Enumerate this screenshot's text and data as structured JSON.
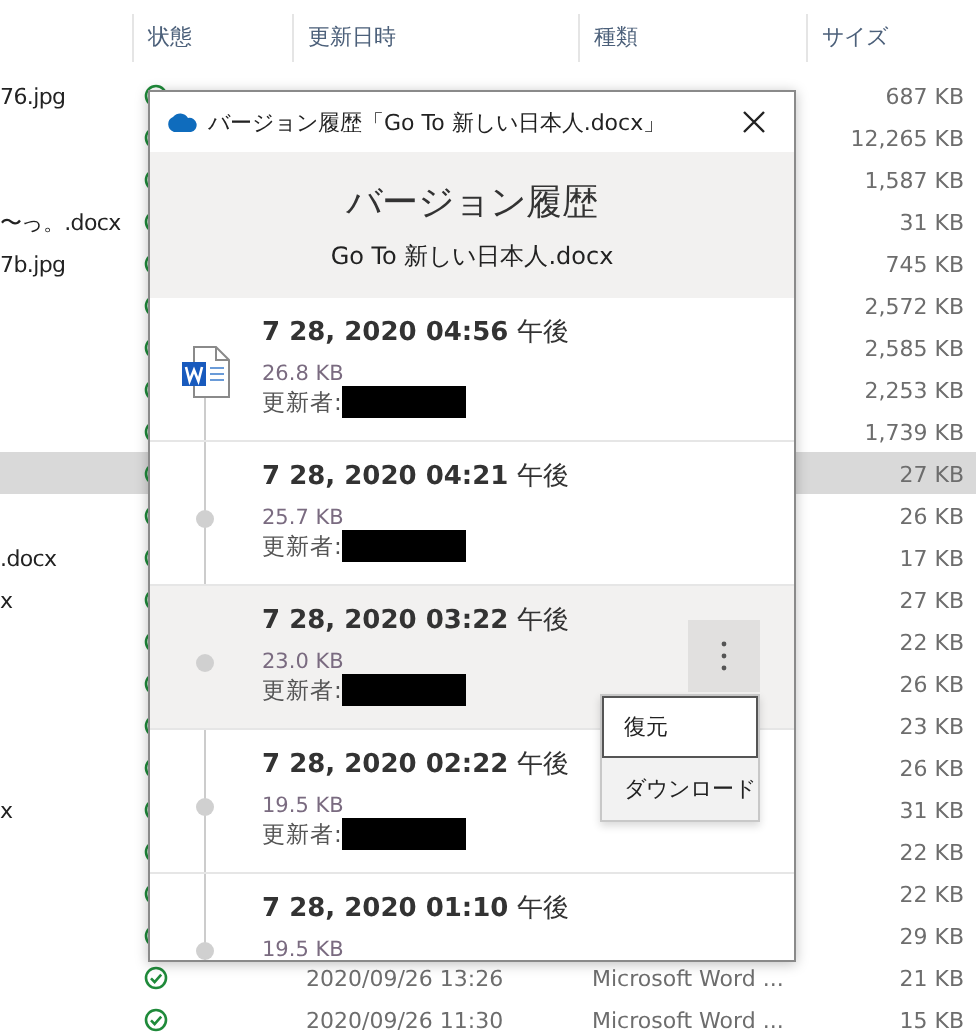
{
  "explorer": {
    "columns": [
      "状態",
      "更新日時",
      "種類",
      "サイズ"
    ],
    "rows": [
      {
        "name": "76.jpg",
        "size": "687 KB",
        "selected": false
      },
      {
        "size": "12,265 KB",
        "selected": false
      },
      {
        "size": "1,587 KB",
        "selected": false
      },
      {
        "name": "〜っ。.docx",
        "size": "31 KB",
        "selected": false
      },
      {
        "name": "7b.jpg",
        "size": "745 KB",
        "selected": false
      },
      {
        "size": "2,572 KB",
        "selected": false
      },
      {
        "size": "2,585 KB",
        "selected": false
      },
      {
        "size": "2,253 KB",
        "selected": false
      },
      {
        "size": "1,739 KB",
        "selected": false
      },
      {
        "size": "27 KB",
        "selected": true
      },
      {
        "size": "26 KB",
        "selected": false
      },
      {
        "name": ".docx",
        "size": "17 KB",
        "selected": false
      },
      {
        "name": "x",
        "size": "27 KB",
        "selected": false
      },
      {
        "size": "22 KB",
        "selected": false
      },
      {
        "size": "26 KB",
        "selected": false
      },
      {
        "size": "23 KB",
        "selected": false
      },
      {
        "size": "26 KB",
        "selected": false
      },
      {
        "name": "x",
        "size": "31 KB",
        "selected": false
      },
      {
        "size": "22 KB",
        "selected": false
      },
      {
        "size": "22 KB",
        "selected": false
      },
      {
        "size": "29 KB",
        "selected": false
      },
      {
        "modified": "2020/09/26 13:26",
        "type": "Microsoft Word ...",
        "size": "21 KB",
        "selected": false
      },
      {
        "modified": "2020/09/26 11:30",
        "type": "Microsoft Word ...",
        "size": "15 KB",
        "selected": false
      }
    ]
  },
  "dialog": {
    "title": "バージョン履歴「Go To 新しい日本人.docx」",
    "heading": "バージョン履歴",
    "filename": "Go To 新しい日本人.docx",
    "versions": [
      {
        "kind": "current",
        "date": "**7 28, 2020 04:56** 午後",
        "size": "26.8 KB",
        "author_label": "更新者:",
        "selected": false
      },
      {
        "kind": "previous",
        "date": "**7 28, 2020 04:21** 午後",
        "size": "25.7 KB",
        "author_label": "更新者:",
        "selected": false
      },
      {
        "kind": "previous",
        "date": "**7 28, 2020 03:22** 午後",
        "size": "23.0 KB",
        "author_label": "更新者:",
        "selected": true
      },
      {
        "kind": "previous",
        "date": "**7 28, 2020 02:22** 午後",
        "size": "19.5 KB",
        "author_label": "更新者:",
        "selected": false
      },
      {
        "kind": "previous",
        "date": "**7 28, 2020 01:10** 午後",
        "size": "19.5 KB",
        "selected": false
      }
    ],
    "context_menu": {
      "items": [
        {
          "label": "復元",
          "selected": true
        },
        {
          "label": "ダウンロード",
          "selected": false
        }
      ]
    }
  }
}
